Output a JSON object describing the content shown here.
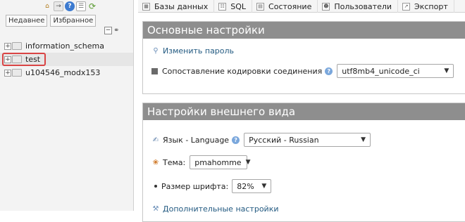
{
  "nav": {
    "tabs": [
      "Недавнее",
      "Избранное"
    ],
    "databases": [
      {
        "label": "information_schema"
      },
      {
        "label": "test",
        "selected": true
      },
      {
        "label": "u104546_modx153"
      }
    ]
  },
  "top_menu": [
    {
      "label": "Базы данных",
      "icon": "database-icon"
    },
    {
      "label": "SQL",
      "icon": "sql-icon"
    },
    {
      "label": "Состояние",
      "icon": "status-icon"
    },
    {
      "label": "Пользователи",
      "icon": "users-icon"
    },
    {
      "label": "Экспорт",
      "icon": "export-icon"
    }
  ],
  "general_settings": {
    "title": "Основные настройки",
    "change_password": "Изменить пароль",
    "collation_label": "Сопоставление кодировки соединения",
    "collation_value": "utf8mb4_unicode_ci"
  },
  "appearance_settings": {
    "title": "Настройки внешнего вида",
    "language_label": "Язык - Language",
    "language_value": "Русский - Russian",
    "theme_label": "Тема:",
    "theme_value": "pmahomme",
    "font_size_label": "Размер шрифта:",
    "font_size_value": "82%",
    "more_settings": "Дополнительные настройки"
  },
  "colors": {
    "panel_header": "#8e8e8e",
    "link": "#235a81",
    "highlight": "#d94444"
  }
}
